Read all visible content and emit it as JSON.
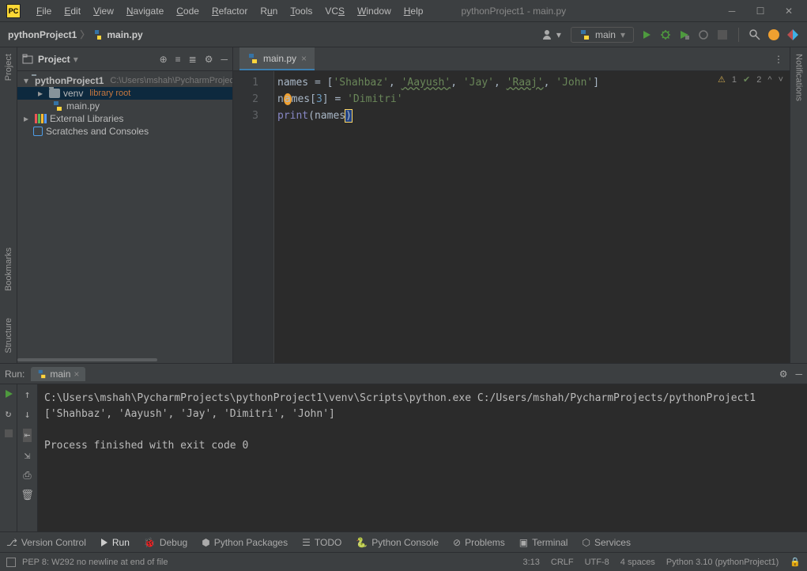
{
  "window": {
    "title": "pythonProject1 - main.py"
  },
  "menu": [
    "File",
    "Edit",
    "View",
    "Navigate",
    "Code",
    "Refactor",
    "Run",
    "Tools",
    "VCS",
    "Window",
    "Help"
  ],
  "breadcrumb": {
    "project": "pythonProject1",
    "file": "main.py"
  },
  "runConfig": {
    "name": "main"
  },
  "projectTool": {
    "title": "Project",
    "root": {
      "name": "pythonProject1",
      "path": "C:\\Users\\mshah\\PycharmProjects"
    },
    "venv": {
      "name": "venv",
      "hint": "library root"
    },
    "file": "main.py",
    "extLib": "External Libraries",
    "scratches": "Scratches and Consoles"
  },
  "editor": {
    "tab": "main.py",
    "gutter": [
      "1",
      "2",
      "3"
    ],
    "inspections": {
      "warn": "1",
      "ok": "2"
    },
    "code": {
      "l1": {
        "a": "names = [",
        "s1": "'Shahbaz'",
        "c": ", ",
        "s2": "'Aayush'",
        "s3": "'Jay'",
        "s4": "'Raaj'",
        "s5": "'John'",
        "z": "]"
      },
      "l2": {
        "a": "names[",
        "n": "3",
        "b": "] = ",
        "s": "'Dimitri'"
      },
      "l3": {
        "fn": "print",
        "a": "(names",
        "b": ")"
      }
    }
  },
  "run": {
    "label": "Run:",
    "tab": "main",
    "out1": "C:\\Users\\mshah\\PycharmProjects\\pythonProject1\\venv\\Scripts\\python.exe C:/Users/mshah/PycharmProjects/pythonProject1",
    "out2": "['Shahbaz', 'Aayush', 'Jay', 'Dimitri', 'John']",
    "out3": "Process finished with exit code 0"
  },
  "bottomTools": {
    "vcs": "Version Control",
    "run": "Run",
    "debug": "Debug",
    "pkg": "Python Packages",
    "todo": "TODO",
    "pycon": "Python Console",
    "prob": "Problems",
    "term": "Terminal",
    "svc": "Services"
  },
  "status": {
    "msg": "PEP 8: W292 no newline at end of file",
    "pos": "3:13",
    "eol": "CRLF",
    "enc": "UTF-8",
    "indent": "4 spaces",
    "interp": "Python 3.10 (pythonProject1)"
  },
  "sideLabels": {
    "project": "Project",
    "bookmarks": "Bookmarks",
    "structure": "Structure",
    "notifications": "Notifications"
  }
}
